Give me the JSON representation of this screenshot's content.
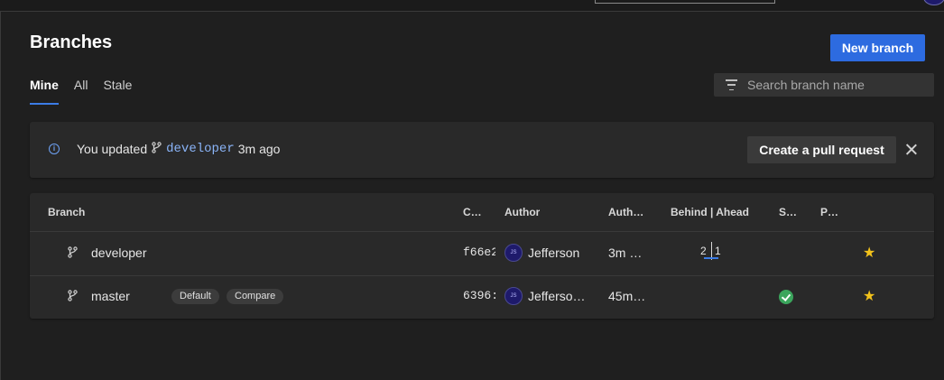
{
  "page": {
    "title": "Branches",
    "new_branch_label": "New branch"
  },
  "tabs": [
    {
      "label": "Mine",
      "active": true
    },
    {
      "label": "All",
      "active": false
    },
    {
      "label": "Stale",
      "active": false
    }
  ],
  "search": {
    "placeholder": "Search branch name",
    "value": ""
  },
  "banner": {
    "prefix": "You updated",
    "branch": "developer",
    "suffix": "3m ago",
    "action_label": "Create a pull request"
  },
  "table": {
    "headers": {
      "branch": "Branch",
      "commit": "C…",
      "author": "Author",
      "authored": "Auth…",
      "behind_ahead": "Behind | Ahead",
      "status": "S…",
      "pr": "P…"
    },
    "rows": [
      {
        "name": "developer",
        "tags": [],
        "commit": "f66e2",
        "avatar_initials": "JS",
        "author": "Jefferson",
        "authored": "3m …",
        "behind": "2",
        "ahead": "1",
        "status": "",
        "favorite": true
      },
      {
        "name": "master",
        "tags": [
          "Default",
          "Compare"
        ],
        "commit": "6396:",
        "avatar_initials": "JS",
        "author": "Jefferso…",
        "authored": "45m…",
        "behind": "",
        "ahead": "",
        "status": "succeeded",
        "favorite": true
      }
    ]
  },
  "colors": {
    "accent": "#2d6be0",
    "link": "#8ab4f8",
    "success": "#3ba55c",
    "star": "#f2c21b"
  },
  "icons": [
    "filter-icon",
    "info-icon",
    "branch-icon",
    "close-icon",
    "check-circle-icon",
    "star-icon"
  ]
}
